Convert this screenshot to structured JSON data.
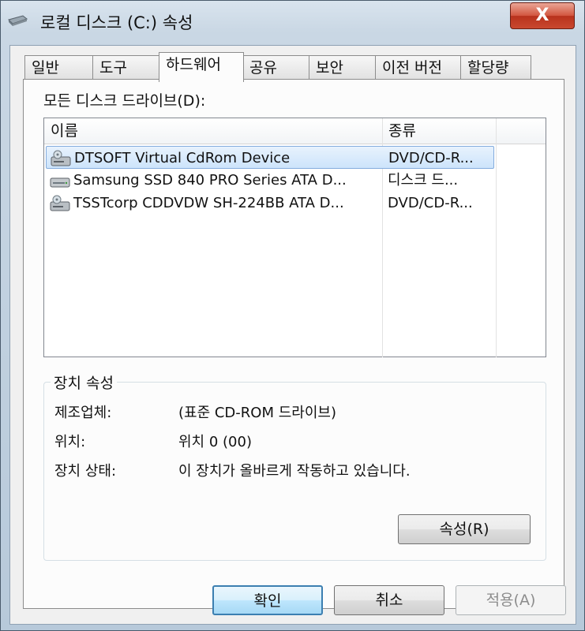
{
  "window": {
    "title": "로컬 디스크 (C:) 속성",
    "close_label": "X"
  },
  "tabs": [
    {
      "label": "일반"
    },
    {
      "label": "도구"
    },
    {
      "label": "하드웨어",
      "active": true
    },
    {
      "label": "공유"
    },
    {
      "label": "보안"
    },
    {
      "label": "이전 버전"
    },
    {
      "label": "할당량"
    }
  ],
  "hardware": {
    "all_disks_label": "모든 디스크 드라이브(D):",
    "columns": {
      "name": "이름",
      "type": "종류"
    },
    "devices": [
      {
        "name": "DTSOFT Virtual CdRom Device",
        "type": "DVD/CD-R...",
        "icon": "cd-drive-icon",
        "selected": true
      },
      {
        "name": "Samsung SSD 840 PRO Series ATA D...",
        "type": "디스크 드...",
        "icon": "hard-disk-icon",
        "selected": false
      },
      {
        "name": "TSSTcorp CDDVDW SH-224BB ATA D...",
        "type": "DVD/CD-R...",
        "icon": "cd-drive-icon",
        "selected": false
      }
    ]
  },
  "device_properties": {
    "group_title": "장치 속성",
    "manufacturer_label": "제조업체:",
    "manufacturer_value": "(표준 CD-ROM 드라이브)",
    "location_label": "위치:",
    "location_value": "위치 0 (00)",
    "status_label": "장치 상태:",
    "status_value": "이 장치가 올바르게 작동하고 있습니다.",
    "properties_button": "속성(R)"
  },
  "footer": {
    "ok": "확인",
    "cancel": "취소",
    "apply": "적용(A)"
  }
}
